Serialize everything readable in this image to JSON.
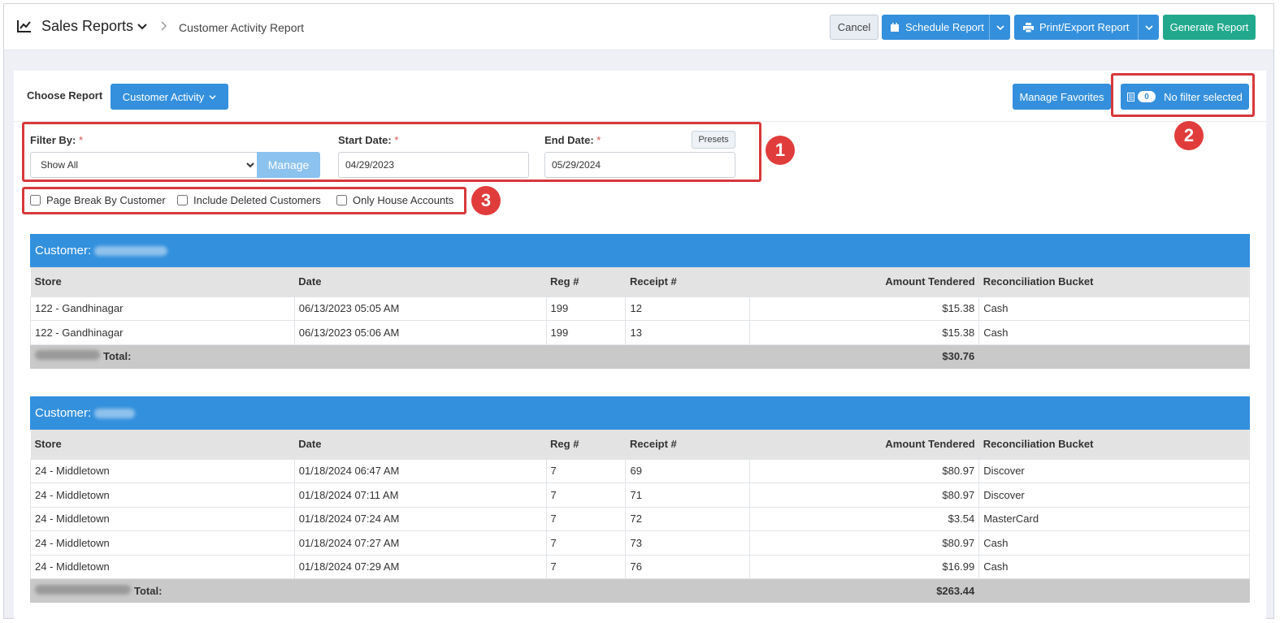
{
  "header": {
    "title": "Sales Reports",
    "breadcrumb": "Customer Activity Report",
    "cancel_label": "Cancel",
    "schedule_label": "Schedule Report",
    "print_label": "Print/Export Report",
    "generate_label": "Generate Report"
  },
  "controls": {
    "choose_report_label": "Choose Report",
    "report_selected": "Customer Activity",
    "manage_favorites_label": "Manage Favorites",
    "filter_count": "0",
    "filter_label": "No filter selected",
    "filter_by_label": "Filter By:",
    "filter_by_value": "Show All",
    "manage_label": "Manage",
    "start_date_label": "Start Date:",
    "start_date_value": "04/29/2023",
    "end_date_label": "End Date:",
    "end_date_value": "05/29/2024",
    "presets_label": "Presets",
    "required_mark": "*"
  },
  "checkboxes": [
    {
      "label": "Page Break By Customer",
      "checked": false
    },
    {
      "label": "Include Deleted Customers",
      "checked": false
    },
    {
      "label": "Only House Accounts",
      "checked": false
    }
  ],
  "callouts": [
    "1",
    "2",
    "3"
  ],
  "columns": [
    "Store",
    "Date",
    "Reg #",
    "Receipt #",
    "Amount Tendered",
    "Reconciliation Bucket"
  ],
  "customer_label": "Customer:",
  "total_label": "Total:",
  "groups": [
    {
      "rows": [
        [
          "122 - Gandhinagar",
          "06/13/2023 05:05 AM",
          "199",
          "12",
          "$15.38",
          "Cash"
        ],
        [
          "122 - Gandhinagar",
          "06/13/2023 05:06 AM",
          "199",
          "13",
          "$15.38",
          "Cash"
        ]
      ],
      "total": "$30.76"
    },
    {
      "rows": [
        [
          "24 - Middletown",
          "01/18/2024 06:47 AM",
          "7",
          "69",
          "$80.97",
          "Discover"
        ],
        [
          "24 - Middletown",
          "01/18/2024 07:11 AM",
          "7",
          "71",
          "$80.97",
          "Discover"
        ],
        [
          "24 - Middletown",
          "01/18/2024 07:24 AM",
          "7",
          "72",
          "$3.54",
          "MasterCard"
        ],
        [
          "24 - Middletown",
          "01/18/2024 07:27 AM",
          "7",
          "73",
          "$80.97",
          "Cash"
        ],
        [
          "24 - Middletown",
          "01/18/2024 07:29 AM",
          "7",
          "76",
          "$16.99",
          "Cash"
        ]
      ],
      "total": "$263.44"
    }
  ],
  "colors": {
    "primary": "#3490dc",
    "success": "#22a98d",
    "highlight": "#d7393b",
    "table_header": "#3390dd"
  }
}
